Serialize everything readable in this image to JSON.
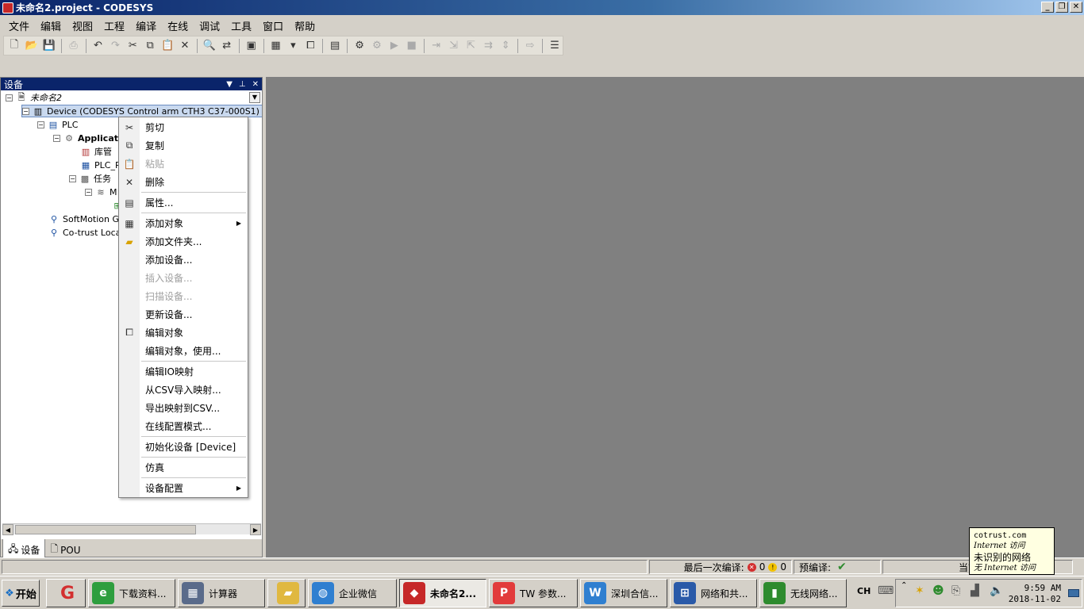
{
  "window": {
    "title": "未命名2.project - CODESYS",
    "controls": [
      "_",
      "❐",
      "✕"
    ]
  },
  "menu": [
    "文件",
    "编辑",
    "视图",
    "工程",
    "编译",
    "在线",
    "调试",
    "工具",
    "窗口",
    "帮助"
  ],
  "devices_panel": {
    "title": "设备",
    "tree": [
      {
        "label": "未命名2",
        "icon": "project-icon"
      },
      {
        "label": "Device (CODESYS Control arm CTH3 C37-000S1)",
        "icon": "device-icon"
      },
      {
        "label": "PLC",
        "icon": "plc-icon"
      },
      {
        "label": "Applicat",
        "icon": "application-gear-icon"
      },
      {
        "label": "库管",
        "icon": "library-manager-icon"
      },
      {
        "label": "PLC_P",
        "icon": "pou-icon"
      },
      {
        "label": "任务",
        "icon": "task-config-icon"
      },
      {
        "label": "M",
        "icon": "task-icon"
      },
      {
        "label": "SoftMotion Ge",
        "icon": "softmotion-icon"
      },
      {
        "label": "Co-trust Local",
        "icon": "cotrust-icon"
      }
    ],
    "tabs": [
      {
        "label": "设备",
        "icon": "devices-tab-icon"
      },
      {
        "label": "POU",
        "icon": "pou-tab-icon"
      }
    ]
  },
  "context_menu": [
    {
      "label": "剪切",
      "icon": "cut-icon",
      "enabled": true
    },
    {
      "label": "复制",
      "icon": "copy-icon",
      "enabled": true
    },
    {
      "label": "粘贴",
      "icon": "paste-icon",
      "enabled": false
    },
    {
      "label": "删除",
      "icon": "delete-icon",
      "enabled": true
    },
    {
      "label": "属性...",
      "icon": "properties-icon",
      "enabled": true
    },
    {
      "label": "添加对象",
      "icon": "add-object-icon",
      "enabled": true,
      "submenu": true
    },
    {
      "label": "添加文件夹...",
      "icon": "folder-icon",
      "enabled": true
    },
    {
      "label": "添加设备...",
      "enabled": true
    },
    {
      "label": "插入设备...",
      "enabled": false
    },
    {
      "label": "扫描设备...",
      "enabled": false
    },
    {
      "label": "更新设备...",
      "enabled": true
    },
    {
      "label": "编辑对象",
      "icon": "edit-object-icon",
      "enabled": true
    },
    {
      "label": "编辑对象，使用...",
      "enabled": true
    },
    {
      "label": "编辑IO映射",
      "enabled": true
    },
    {
      "label": "从CSV导入映射...",
      "enabled": true
    },
    {
      "label": "导出映射到CSV...",
      "enabled": true
    },
    {
      "label": "在线配置模式...",
      "enabled": true
    },
    {
      "label": "初始化设备 [Device]",
      "enabled": true
    },
    {
      "label": "仿真",
      "enabled": true
    },
    {
      "label": "设备配置",
      "enabled": true,
      "submenu": true
    }
  ],
  "status": {
    "last_compile_label": "最后一次编译:",
    "errors": "0",
    "warnings": "0",
    "precompile_label": "预编译:",
    "current_user_label": "当前用户"
  },
  "tooltip": {
    "host": "cotrust.com",
    "access1": "Internet 访问",
    "network": "未识别的网络",
    "access2": "无 Internet 访问"
  },
  "taskbar": {
    "start_label": "开始",
    "buttons": [
      {
        "label": "下载资料...",
        "icon": "browser-icon",
        "color": "#2e9e3e"
      },
      {
        "label": "计算器",
        "icon": "calculator-icon",
        "color": "#5a6b8a"
      },
      {
        "label": "企业微信",
        "icon": "wecom-icon",
        "color": "#2f7fd0"
      },
      {
        "label": "未命名2...",
        "icon": "codesys-icon",
        "color": "#c62828",
        "active": true
      },
      {
        "label": "TW 参数...",
        "icon": "wps-pdf-icon",
        "color": "#e23b3b"
      },
      {
        "label": "深圳合信...",
        "icon": "wps-writer-icon",
        "color": "#2f7fd0"
      },
      {
        "label": "网络和共...",
        "icon": "network-center-icon",
        "color": "#2a5aa8"
      },
      {
        "label": "无线网络...",
        "icon": "wireless-icon",
        "color": "#2e8b2e"
      }
    ],
    "language": "CH",
    "clock_time": "9:59 AM",
    "clock_date": "2018-11-02"
  },
  "colors": {
    "title_bar": "#0a246a",
    "work_area": "#808080",
    "panel_header": "#0a246a"
  }
}
